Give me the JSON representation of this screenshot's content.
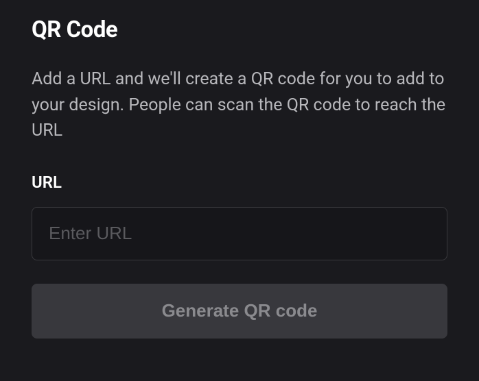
{
  "panel": {
    "title": "QR Code",
    "description": "Add a URL and we'll create a QR code for you to add to your design. People can scan the QR code to reach the URL",
    "url_field": {
      "label": "URL",
      "placeholder": "Enter URL",
      "value": ""
    },
    "generate_button_label": "Generate QR code"
  }
}
